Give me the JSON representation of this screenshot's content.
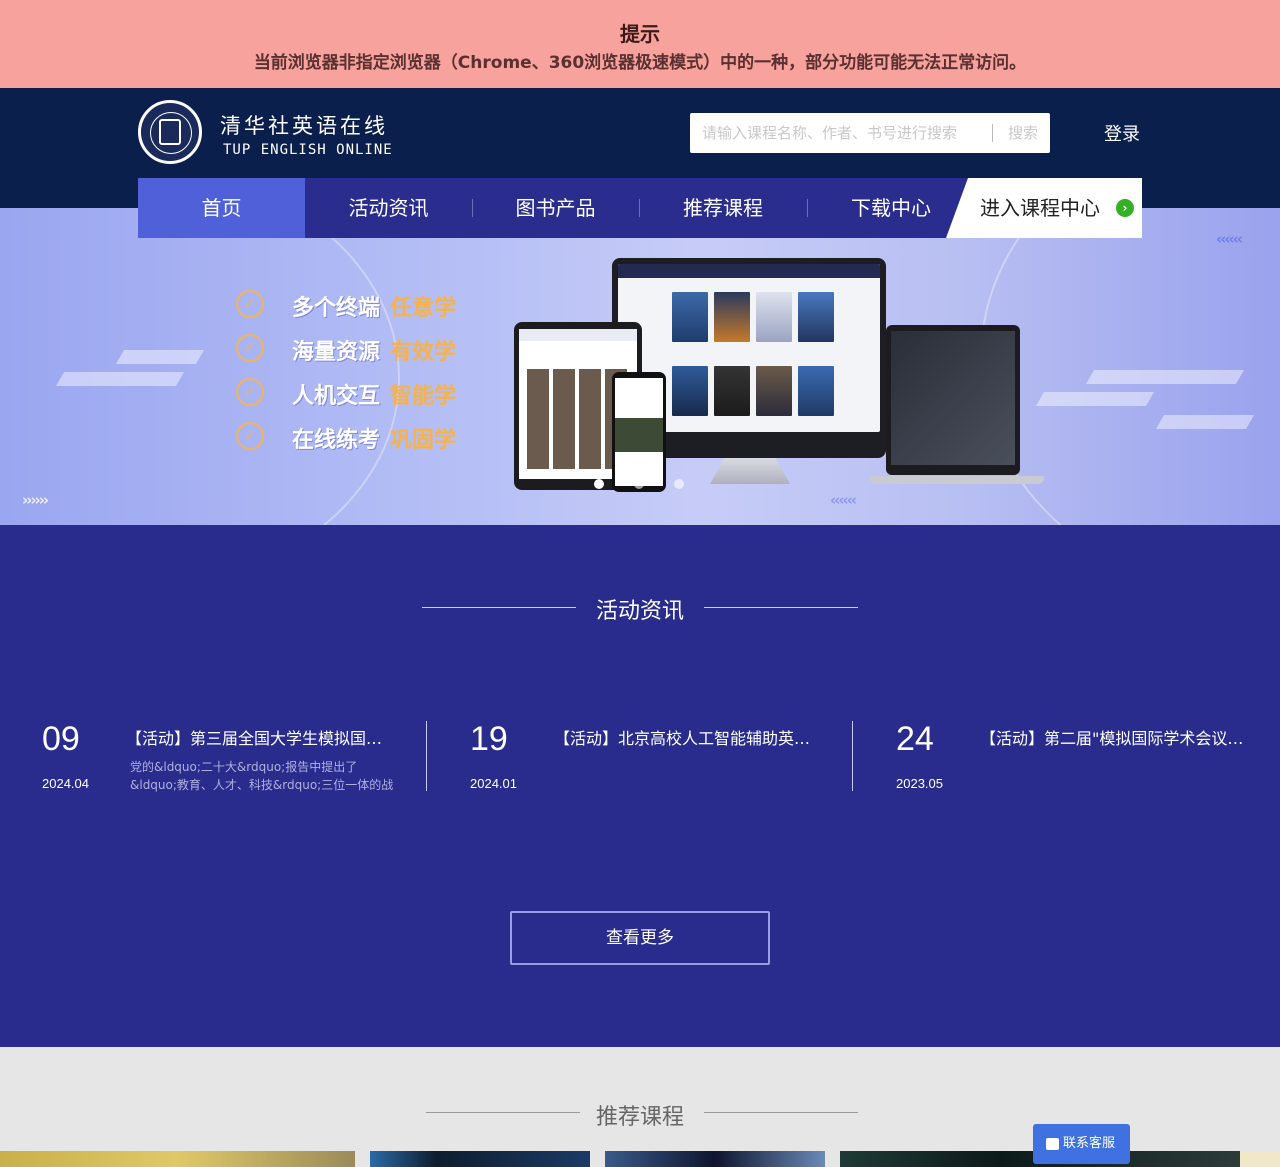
{
  "warning": {
    "title": "提示",
    "message": "当前浏览器非指定浏览器（Chrome、360浏览器极速模式）中的一种，部分功能可能无法正常访问。"
  },
  "brand": {
    "name_cn": "清华社英语在线",
    "name_en": "TUP ENGLISH ONLINE"
  },
  "search": {
    "placeholder": "请输入课程名称、作者、书号进行搜索",
    "button": "搜索"
  },
  "header": {
    "login": "登录"
  },
  "nav": {
    "items": [
      {
        "label": "首页",
        "active": true
      },
      {
        "label": "活动资讯"
      },
      {
        "label": "图书产品"
      },
      {
        "label": "推荐课程"
      },
      {
        "label": "下载中心"
      }
    ],
    "cta": "进入课程中心"
  },
  "banner": {
    "features": [
      {
        "a": "多个终端",
        "b": "任意学"
      },
      {
        "a": "海量资源",
        "b": "有效学"
      },
      {
        "a": "人机交互",
        "b": "智能学"
      },
      {
        "a": "在线练考",
        "b": "巩固学"
      }
    ],
    "slides": 3,
    "active_slide": 1
  },
  "news": {
    "title": "活动资讯",
    "items": [
      {
        "day": "09",
        "month": "2024.04",
        "title": "【活动】第三届全国大学生模拟国际学术会议大赛",
        "desc": "党的&ldquo;二十大&rdquo;报告中提出了&ldquo;教育、人才、科技&rdquo;三位一体的战略，要求加快建设教育强国、科技强国、人才强国"
      },
      {
        "day": "19",
        "month": "2024.01",
        "title": "【活动】北京高校人工智能辅助英语教学研讨会",
        "desc": ""
      },
      {
        "day": "24",
        "month": "2023.05",
        "title": "【活动】第二届\"模拟国际学术会议大赛\"",
        "desc": ""
      }
    ],
    "more": "查看更多"
  },
  "courses": {
    "title": "推荐课程"
  },
  "kefu": "联系客服",
  "colors": {
    "warning_bg": "#f7a29c",
    "header_bg": "#0b1f4d",
    "nav_bg": "#2a2d8d",
    "nav_active": "#5060d8",
    "news_bg": "#292c8c",
    "accent_orange": "#f6b34c",
    "cta_green": "#35b024",
    "kefu_blue": "#3f72e0"
  }
}
